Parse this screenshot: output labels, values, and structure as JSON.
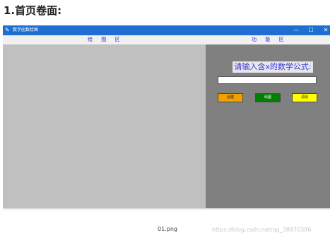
{
  "page": {
    "heading": "1.首页卷面:",
    "caption": "01.png",
    "watermark": "https://blog.csdn.net/qq_38870386"
  },
  "window": {
    "title": "数学函数绘图",
    "app_icon": "feather-icon",
    "controls": {
      "minimize": "—",
      "maximize": "☐",
      "close": "✕"
    },
    "labels": {
      "drawing_area": "绘 图 区",
      "function_area": "功 能 区"
    }
  },
  "function_panel": {
    "prompt": "请输入含x的数学公式:",
    "formula_value": "",
    "formula_placeholder": "",
    "buttons": {
      "create": "创建",
      "draw": "绘图",
      "clear": "清除"
    }
  },
  "colors": {
    "titlebar": "#1e6fd1",
    "drawing_area_bg": "#c0c0c0",
    "function_area_bg": "#808080",
    "create_button": "#f2a000",
    "draw_button": "#008000",
    "clear_button": "#ffff00",
    "label_text": "#2a2ad0"
  }
}
